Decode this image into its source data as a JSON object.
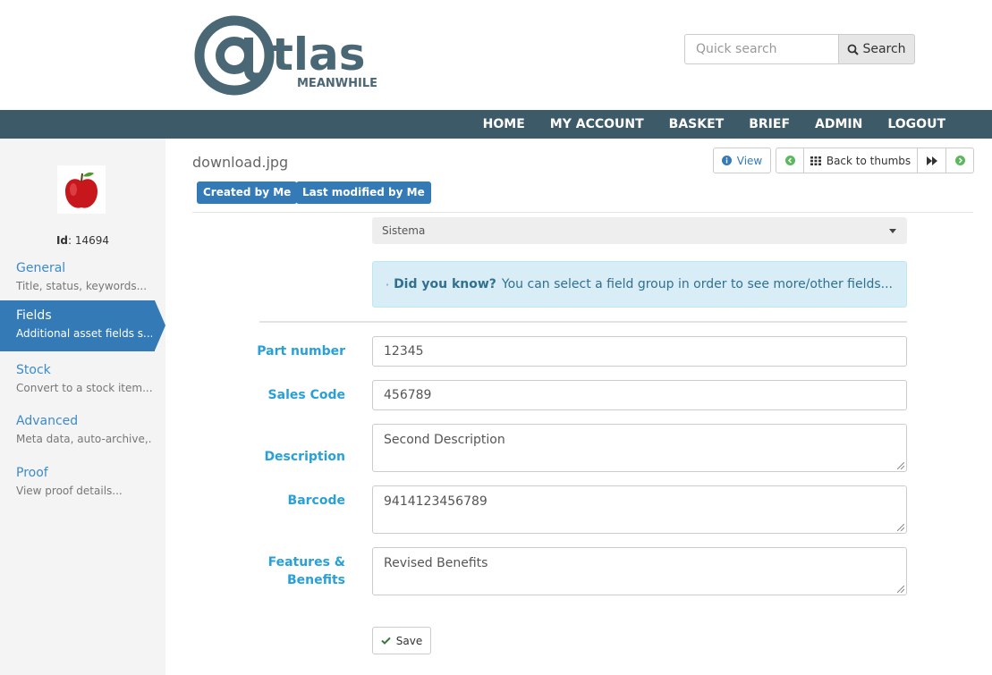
{
  "brand": {
    "logo_text": "tlas",
    "logo_sub": "MEANWHILE"
  },
  "search": {
    "placeholder": "Quick search",
    "button_label": "Search"
  },
  "nav": [
    "HOME",
    "MY ACCOUNT",
    "BASKET",
    "BRIEF",
    "ADMIN",
    "LOGOUT"
  ],
  "sidebar": {
    "id_label": "Id",
    "id_value": ": 14694",
    "items": [
      {
        "title": "General",
        "subtitle": "Title, status, keywords..."
      },
      {
        "title": "Fields",
        "subtitle": "Additional asset fields s..."
      },
      {
        "title": "Stock",
        "subtitle": "Convert to a stock item..."
      },
      {
        "title": "Advanced",
        "subtitle": "Meta data, auto-archive,..."
      },
      {
        "title": "Proof",
        "subtitle": "View proof details..."
      }
    ]
  },
  "asset": {
    "filename": "download.jpg",
    "badges": [
      "Created by Me",
      "Last modified by Me"
    ]
  },
  "toolbar": {
    "view_label": "View",
    "back_label": "Back to thumbs"
  },
  "group_select": {
    "value": "Sistema"
  },
  "info": {
    "bold": "Did you know?",
    "text": "You can select a field group in order to see more/other fields..."
  },
  "fields": [
    {
      "label": "Part number",
      "value": "12345"
    },
    {
      "label": "Sales Code",
      "value": "456789"
    },
    {
      "label": "Description",
      "value": "Second Description"
    },
    {
      "label": "Barcode",
      "value": "9414123456789"
    },
    {
      "label_line1": "Features &",
      "label_line2": "Benefits",
      "value": "Revised Benefits"
    }
  ],
  "save_label": "Save",
  "colors": {
    "nav_bg": "#3d5a68",
    "primary": "#337ab7",
    "label": "#29a0d8",
    "info_bg": "#d9edf7"
  }
}
